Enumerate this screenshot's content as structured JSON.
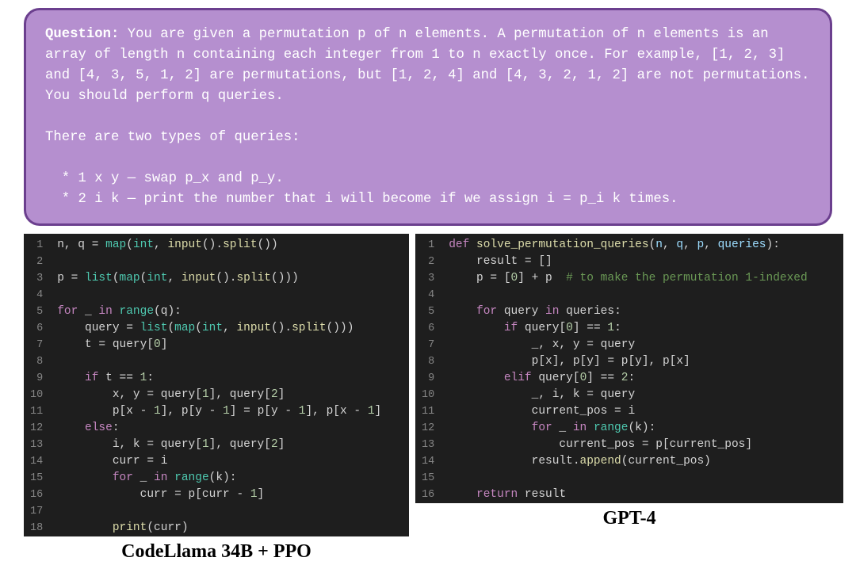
{
  "question": {
    "label": "Question:",
    "body": " You are given a permutation p of n elements. A permutation of n elements is an array of length n containing each integer from 1 to n exactly once. For example, [1, 2, 3] and [4, 3, 5, 1, 2] are permutations, but [1, 2, 4] and [4, 3, 2, 1, 2] are not permutations. You should perform q queries.",
    "sub1": "There are two types of queries:",
    "bullet1": "  * 1 x y — swap p_x and p_y.",
    "bullet2": "  * 2 i k — print the number that i will become if we assign i = p_i k times."
  },
  "left": {
    "caption": "CodeLlama 34B + PPO",
    "lines": 18,
    "code": [
      {
        "n": 1,
        "html": "n, q = <span class='bi'>map</span>(<span class='bi'>int</span>, <span class='fn'>input</span>().<span class='fn'>split</span>())"
      },
      {
        "n": 2,
        "html": ""
      },
      {
        "n": 3,
        "html": "p = <span class='bi'>list</span>(<span class='bi'>map</span>(<span class='bi'>int</span>, <span class='fn'>input</span>().<span class='fn'>split</span>()))"
      },
      {
        "n": 4,
        "html": ""
      },
      {
        "n": 5,
        "html": "<span class='kw'>for</span> _ <span class='kw'>in</span> <span class='bi'>range</span>(q):"
      },
      {
        "n": 6,
        "html": "    query = <span class='bi'>list</span>(<span class='bi'>map</span>(<span class='bi'>int</span>, <span class='fn'>input</span>().<span class='fn'>split</span>()))"
      },
      {
        "n": 7,
        "html": "    t = query[<span class='nm'>0</span>]"
      },
      {
        "n": 8,
        "html": ""
      },
      {
        "n": 9,
        "html": "    <span class='kw'>if</span> t == <span class='nm'>1</span>:"
      },
      {
        "n": 10,
        "html": "        x, y = query[<span class='nm'>1</span>], query[<span class='nm'>2</span>]"
      },
      {
        "n": 11,
        "html": "        p[x - <span class='nm'>1</span>], p[y - <span class='nm'>1</span>] = p[y - <span class='nm'>1</span>], p[x - <span class='nm'>1</span>]"
      },
      {
        "n": 12,
        "html": "    <span class='kw'>else</span>:"
      },
      {
        "n": 13,
        "html": "        i, k = query[<span class='nm'>1</span>], query[<span class='nm'>2</span>]"
      },
      {
        "n": 14,
        "html": "        curr = i"
      },
      {
        "n": 15,
        "html": "        <span class='kw'>for</span> _ <span class='kw'>in</span> <span class='bi'>range</span>(k):"
      },
      {
        "n": 16,
        "html": "            curr = p[curr - <span class='nm'>1</span>]"
      },
      {
        "n": 17,
        "html": ""
      },
      {
        "n": 18,
        "html": "        <span class='fn'>print</span>(curr)"
      }
    ]
  },
  "right": {
    "caption": "GPT-4",
    "lines": 16,
    "code": [
      {
        "n": 1,
        "html": "<span class='kw'>def</span> <span class='fnname'>solve_permutation_queries</span>(<span class='va'>n</span>, <span class='va'>q</span>, <span class='va'>p</span>, <span class='va'>queries</span>):"
      },
      {
        "n": 2,
        "html": "    result = []"
      },
      {
        "n": 3,
        "html": "    p = [<span class='nm'>0</span>] + p  <span class='cm'># to make the permutation 1-indexed</span>"
      },
      {
        "n": 4,
        "html": ""
      },
      {
        "n": 5,
        "html": "    <span class='kw'>for</span> query <span class='kw'>in</span> queries:"
      },
      {
        "n": 6,
        "html": "        <span class='kw'>if</span> query[<span class='nm'>0</span>] == <span class='nm'>1</span>:"
      },
      {
        "n": 7,
        "html": "            _, x, y = query"
      },
      {
        "n": 8,
        "html": "            p[x], p[y] = p[y], p[x]"
      },
      {
        "n": 9,
        "html": "        <span class='kw'>elif</span> query[<span class='nm'>0</span>] == <span class='nm'>2</span>:"
      },
      {
        "n": 10,
        "html": "            _, i, k = query"
      },
      {
        "n": 11,
        "html": "            current_pos = i"
      },
      {
        "n": 12,
        "html": "            <span class='kw'>for</span> _ <span class='kw'>in</span> <span class='bi'>range</span>(k):"
      },
      {
        "n": 13,
        "html": "                current_pos = p[current_pos]"
      },
      {
        "n": 14,
        "html": "            result.<span class='fn'>append</span>(current_pos)"
      },
      {
        "n": 15,
        "html": ""
      },
      {
        "n": 16,
        "html": "    <span class='kw'>return</span> result"
      }
    ]
  }
}
